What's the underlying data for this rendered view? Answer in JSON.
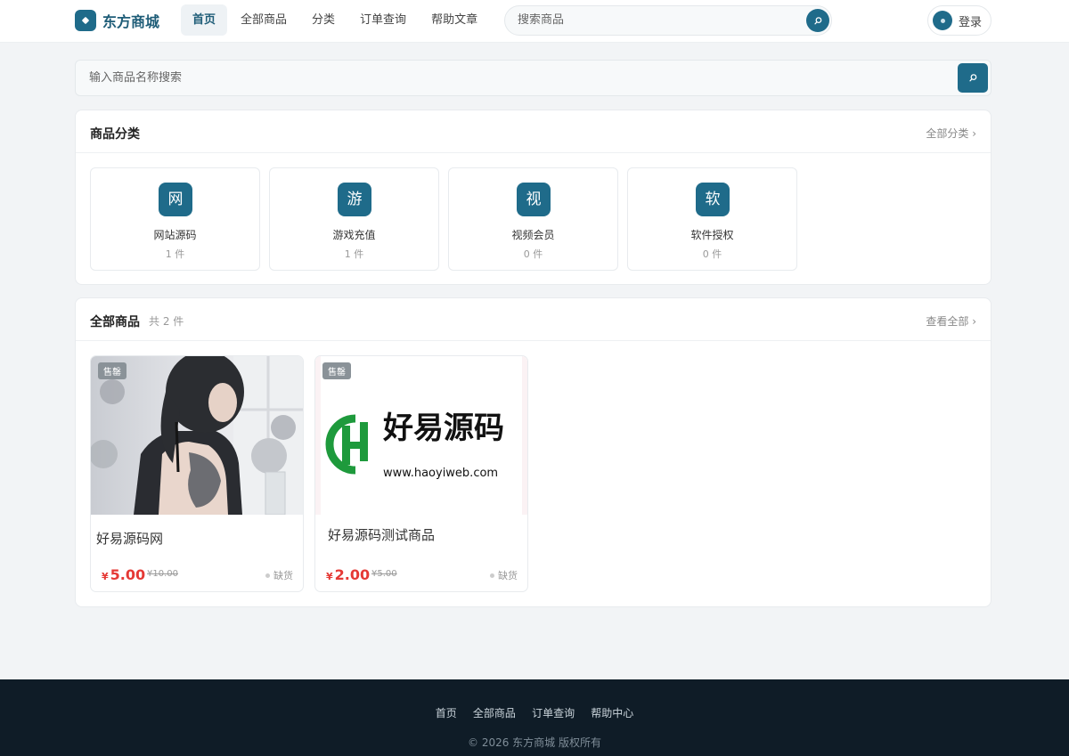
{
  "header": {
    "brand": "东方商城",
    "nav": [
      "首页",
      "全部商品",
      "分类",
      "订单查询",
      "帮助文章"
    ],
    "search_placeholder": "搜索商品",
    "login_label": "登录"
  },
  "main_search": {
    "placeholder": "输入商品名称搜索"
  },
  "categories": {
    "title": "商品分类",
    "link": "全部分类 ›",
    "items": [
      {
        "icon": "网",
        "name": "网站源码",
        "count": "1 件"
      },
      {
        "icon": "游",
        "name": "游戏充值",
        "count": "1 件"
      },
      {
        "icon": "视",
        "name": "视频会员",
        "count": "0 件"
      },
      {
        "icon": "软",
        "name": "软件授权",
        "count": "0 件"
      }
    ]
  },
  "products": {
    "title": "全部商品",
    "subtitle": "共 2 件",
    "link": "查看全部 ›",
    "items": [
      {
        "badge": "售罄",
        "name": "好易源码网",
        "currency": "¥",
        "price": "5.00",
        "orig": "¥10.00",
        "stock": "缺货"
      },
      {
        "badge": "售罄",
        "name": "好易源码测试商品",
        "currency": "¥",
        "price": "2.00",
        "orig": "¥5.00",
        "stock": "缺货",
        "image_brand": "好易源码",
        "image_url": "www.haoyiweb.com"
      }
    ]
  },
  "footer": {
    "links": [
      "首页",
      "全部商品",
      "订单查询",
      "帮助中心"
    ],
    "copyright": "© 2026 东方商城 版权所有"
  },
  "colors": {
    "accent": "#1f6b8a",
    "price": "#e53935",
    "footer_bg": "#0f1c27"
  }
}
